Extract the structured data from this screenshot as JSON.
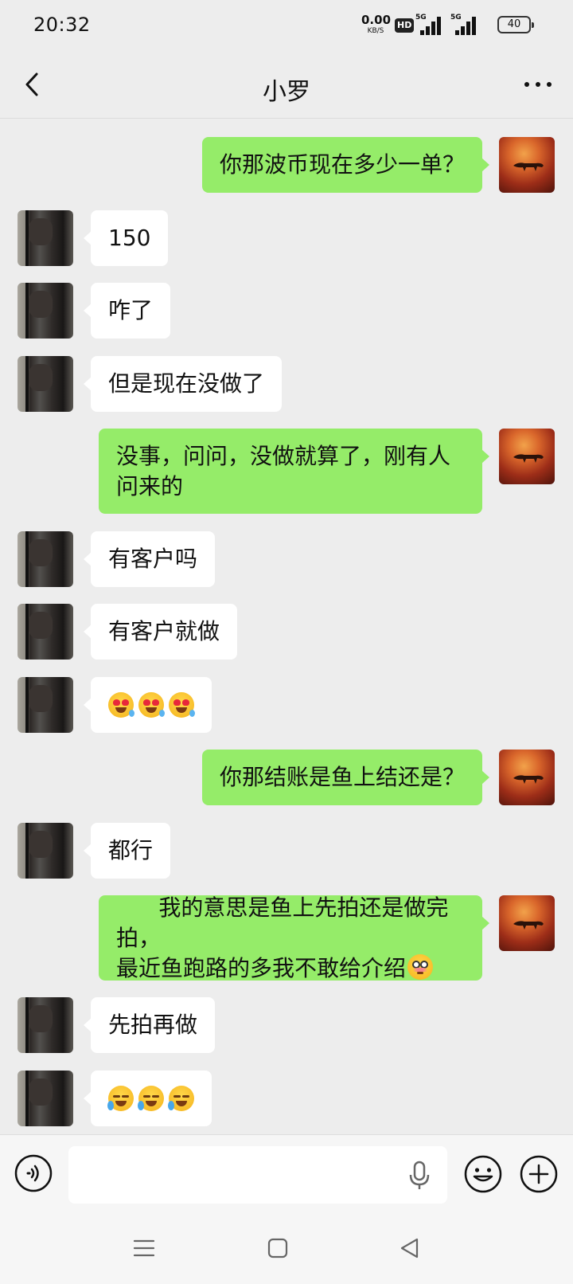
{
  "status_bar": {
    "time": "20:32",
    "net_speed_value": "0.00",
    "net_speed_unit": "KB/S",
    "hd_badge": "HD",
    "signal_label_1": "5G",
    "signal_label_2": "5G",
    "battery": "40"
  },
  "header": {
    "title": "小罗",
    "back_icon": "chevron-left-icon",
    "more_icon": "more-dots-icon"
  },
  "messages": [
    {
      "from": "self",
      "text": "你那波币现在多少一单？"
    },
    {
      "from": "other",
      "text": "150"
    },
    {
      "from": "other",
      "text": "咋了"
    },
    {
      "from": "other",
      "text": "但是现在没做了"
    },
    {
      "from": "self",
      "text": "没事，问问，没做就算了，刚有人\n问来的"
    },
    {
      "from": "other",
      "text": "有客户吗"
    },
    {
      "from": "other",
      "text": "有客户就做"
    },
    {
      "from": "other",
      "text": "",
      "emojis": [
        "heart-eyes-drool-emoji",
        "heart-eyes-drool-emoji",
        "heart-eyes-drool-emoji"
      ]
    },
    {
      "from": "self",
      "text": "你那结账是鱼上结还是？"
    },
    {
      "from": "other",
      "text": "都行"
    },
    {
      "from": "self",
      "text": "我的意思是鱼上先拍还是做完拍，\n最近鱼跑路的多我不敢给介绍",
      "trailing_emoji": "flushed-emoji"
    },
    {
      "from": "other",
      "text": "先拍再做"
    },
    {
      "from": "other",
      "text": "",
      "emojis": [
        "crying-laughing-emoji",
        "crying-laughing-emoji",
        "crying-laughing-emoji"
      ]
    }
  ],
  "input_bar": {
    "voice_icon": "voice-mode-icon",
    "mic_icon": "microphone-icon",
    "emoji_icon": "smiley-icon",
    "plus_icon": "plus-circle-icon",
    "text_value": ""
  },
  "system_nav": {
    "menu_icon": "menu-icon",
    "home_icon": "home-square-icon",
    "back_icon": "back-triangle-icon"
  },
  "colors": {
    "background": "#ededed",
    "self_bubble": "#95ec69",
    "other_bubble": "#ffffff"
  }
}
